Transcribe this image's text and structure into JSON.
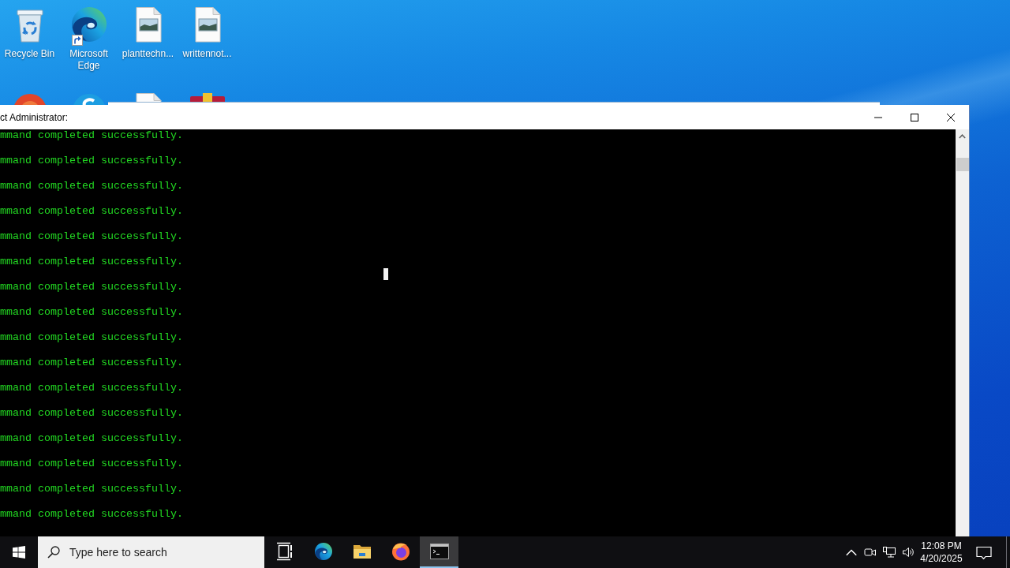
{
  "desktop": {
    "icons": [
      {
        "kind": "recycle-bin",
        "label": "Recycle Bin",
        "shortcut": false
      },
      {
        "kind": "edge",
        "label": "Microsoft Edge",
        "shortcut": true
      },
      {
        "kind": "image-file",
        "label": "planttechn...",
        "shortcut": false
      },
      {
        "kind": "image-file",
        "label": "writtennot...",
        "shortcut": false
      },
      {
        "kind": "round-red",
        "shortcut": false
      },
      {
        "kind": "round-blue",
        "shortcut": false
      },
      {
        "kind": "document",
        "shortcut": false
      },
      {
        "kind": "archive",
        "shortcut": false
      }
    ]
  },
  "console_window": {
    "title": "ct Administrator:",
    "lines": [
      {
        "text": "mmand completed successfully.",
        "cursor": false
      },
      {
        "text": "mmand completed successfully.",
        "cursor": false
      },
      {
        "text": "mmand completed successfully.",
        "cursor": false
      },
      {
        "text": "mmand completed successfully.",
        "cursor": false
      },
      {
        "text": "mmand completed successfully.",
        "cursor": false
      },
      {
        "text": "mmand completed successfully.",
        "cursor": true
      },
      {
        "text": "mmand completed successfully.",
        "cursor": false
      },
      {
        "text": "mmand completed successfully.",
        "cursor": false
      },
      {
        "text": "mmand completed successfully.",
        "cursor": false
      },
      {
        "text": "mmand completed successfully.",
        "cursor": false
      },
      {
        "text": "mmand completed successfully.",
        "cursor": false
      },
      {
        "text": "mmand completed successfully.",
        "cursor": false
      },
      {
        "text": "mmand completed successfully.",
        "cursor": false
      },
      {
        "text": "mmand completed successfully.",
        "cursor": false
      },
      {
        "text": "mmand completed successfully.",
        "cursor": false
      },
      {
        "text": "mmand completed successfully.",
        "cursor": false
      }
    ]
  },
  "taskbar": {
    "search": {
      "placeholder": "Type here to search"
    },
    "apps": [
      {
        "kind": "task-view",
        "selected": false
      },
      {
        "kind": "edge",
        "selected": false
      },
      {
        "kind": "file-explorer",
        "selected": false
      },
      {
        "kind": "firefox",
        "selected": false
      },
      {
        "kind": "terminal",
        "selected": true
      }
    ],
    "tray": {
      "time": "12:08 PM",
      "date": "4/20/2025"
    }
  }
}
